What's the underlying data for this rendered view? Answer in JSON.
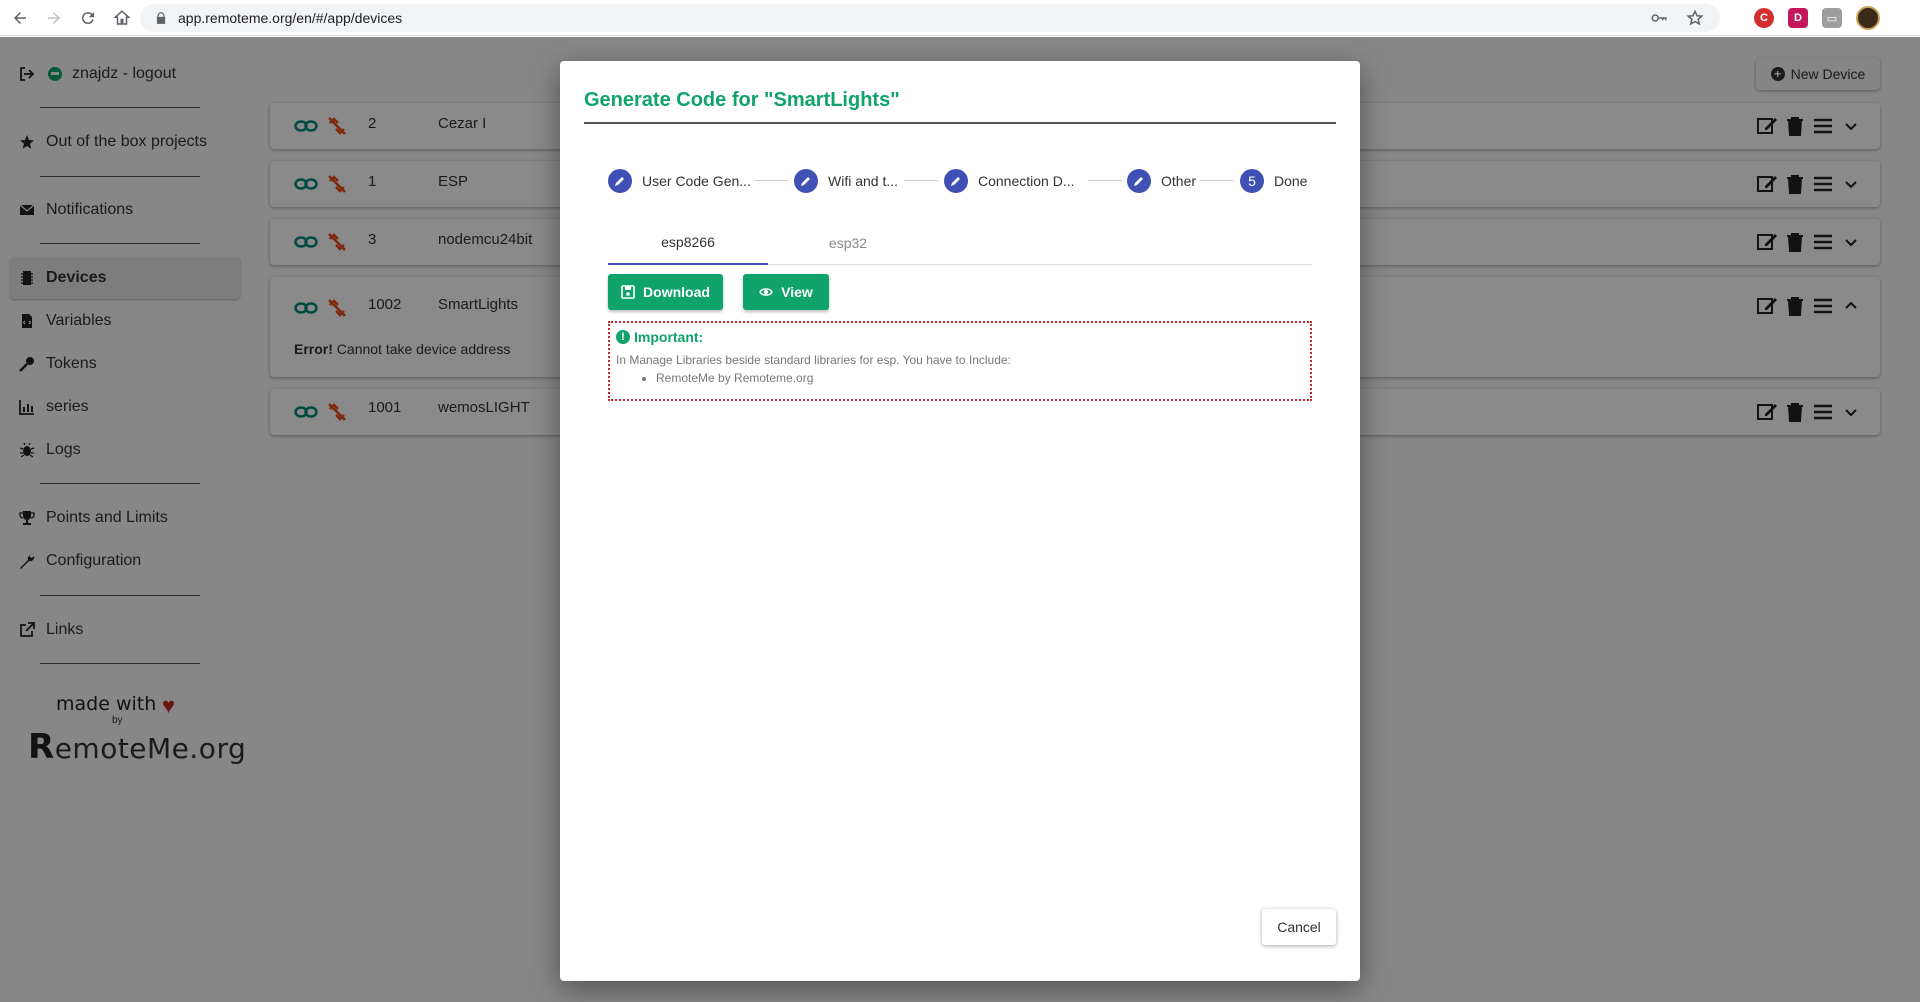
{
  "browser": {
    "url": "app.remoteme.org/en/#/app/devices"
  },
  "sidebar": {
    "user_label": "znajdz - logout",
    "items": [
      {
        "label": "Out of the box projects",
        "icon": "star-icon"
      },
      {
        "label": "Notifications",
        "icon": "envelope-icon"
      },
      {
        "label": "Devices",
        "icon": "microchip-icon"
      },
      {
        "label": "Variables",
        "icon": "file-code-icon"
      },
      {
        "label": "Tokens",
        "icon": "key-icon"
      },
      {
        "label": "series",
        "icon": "chart-icon"
      },
      {
        "label": "Logs",
        "icon": "bug-icon"
      },
      {
        "label": "Points and Limits",
        "icon": "trophy-icon"
      },
      {
        "label": "Configuration",
        "icon": "wrench-icon"
      },
      {
        "label": "Links",
        "icon": "external-link-icon"
      }
    ],
    "made_with": "made with",
    "by": "by",
    "brand_r": "R",
    "brand_rest": "emoteMe.org"
  },
  "header": {
    "new_device_label": "New Device"
  },
  "devices": [
    {
      "id": "2",
      "name": "Cezar I"
    },
    {
      "id": "1",
      "name": "ESP"
    },
    {
      "id": "3",
      "name": "nodemcu24bit"
    },
    {
      "id": "1002",
      "name": "SmartLights",
      "error_bold": "Error!",
      "error_text": " Cannot take device address"
    },
    {
      "id": "1001",
      "name": "wemosLIGHT"
    }
  ],
  "modal": {
    "title": "Generate Code for \"SmartLights\"",
    "steps": [
      {
        "label": "User Code Gen..."
      },
      {
        "label": "Wifi and t..."
      },
      {
        "label": "Connection D..."
      },
      {
        "label": "Other"
      },
      {
        "label": "Done",
        "number": "5"
      }
    ],
    "tabs": [
      {
        "label": "esp8266"
      },
      {
        "label": "esp32"
      }
    ],
    "download_label": "Download",
    "view_label": "View",
    "important_title": "Important:",
    "important_text": "In Manage Libraries beside standard libraries for esp. You have to Include:",
    "important_items": [
      "RemoteMe by Remoteme.org"
    ],
    "cancel_label": "Cancel"
  },
  "colors": {
    "accent_green": "#10a36b",
    "step_blue": "#3f51b5",
    "error_red": "#c62828",
    "link_icon_teal": "#00897b",
    "unlink_icon_orange": "#e64a19"
  }
}
